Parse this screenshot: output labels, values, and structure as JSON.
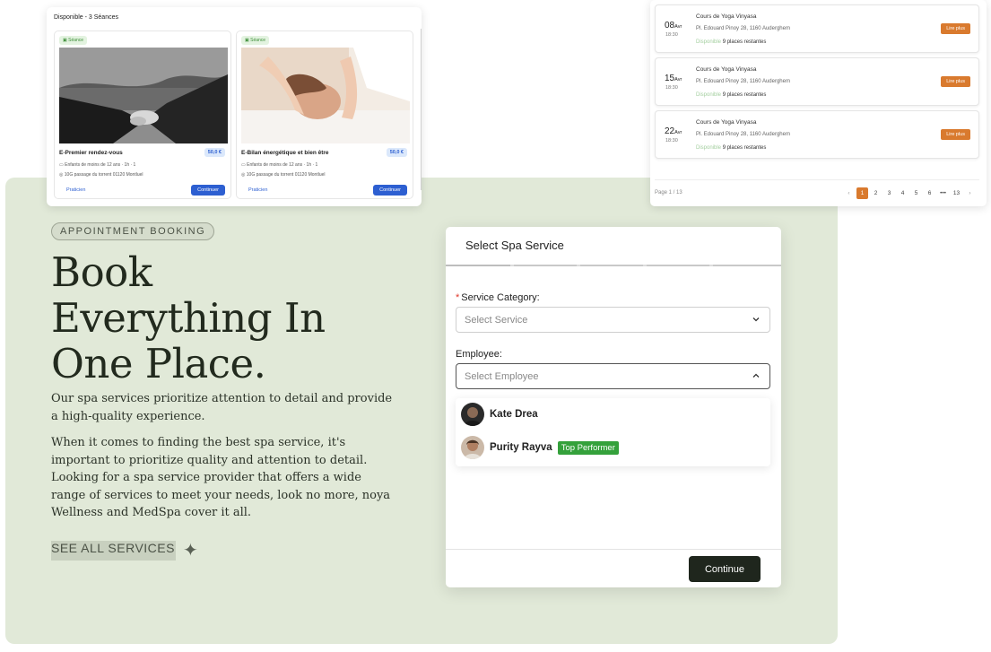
{
  "cards": {
    "title": "Disponible - 3 Séances",
    "items": [
      {
        "badge": "Séance",
        "title": "E-Premier rendez-vous",
        "price": "50,0 €",
        "meta": "Enfants de moins de 12 ans  ·  1h  ·  1",
        "address": "10G passage du torrent 01120 Montluel",
        "practitioner": "Praticien",
        "continue": "Continuer"
      },
      {
        "badge": "Séance",
        "title": "E-Bilan énergétique et bien être",
        "price": "50,0 €",
        "meta": "Enfants de moins de 12 ans  ·  1h  ·  1",
        "address": "10G passage du torrent 01120 Montluel",
        "practitioner": "Praticien",
        "continue": "Continuer"
      }
    ]
  },
  "sessions": {
    "items": [
      {
        "day": "08",
        "month": "Avr",
        "time": "18:30",
        "title": "Cours de Yoga Vinyasa",
        "address": "Pl. Edouard Pinoy 28, 1160 Auderghem",
        "available_label": "Disponible",
        "places": "9 places restantes",
        "button": "Lire plus"
      },
      {
        "day": "15",
        "month": "Avr",
        "time": "18:30",
        "title": "Cours de Yoga Vinyasa",
        "address": "Pl. Edouard Pinoy 28, 1160 Auderghem",
        "available_label": "Disponible",
        "places": "9 places restantes",
        "button": "Lire plus"
      },
      {
        "day": "22",
        "month": "Avr",
        "time": "18:30",
        "title": "Cours de Yoga Vinyasa",
        "address": "Pl. Edouard Pinoy 28, 1160 Auderghem",
        "available_label": "Disponible",
        "places": "9 places restantes",
        "button": "Lire plus"
      }
    ],
    "page_info": "Page 1 / 13",
    "pages": [
      "1",
      "2",
      "3",
      "4",
      "5",
      "6",
      "•••",
      "13"
    ],
    "active_page": "1"
  },
  "hero": {
    "eyebrow": "APPOINTMENT BOOKING",
    "heading_line1": "Book",
    "heading_line2": "Everything In",
    "heading_line3": "One Place.",
    "para1": "Our spa services prioritize attention to detail and provide a high-quality experience.",
    "para2": "When it comes to finding the best spa service, it's important to prioritize quality and attention to detail. Looking for a spa service provider that offers a wide range of services to meet your needs, look no more, noya Wellness and MedSpa cover it all.",
    "see_all": "SEE ALL SERVICES"
  },
  "modal": {
    "title": "Select Spa Service",
    "category_label": "Service Category:",
    "category_required_mark": "*",
    "category_placeholder": "Select Service",
    "employee_label": "Employee:",
    "employee_placeholder": "Select Employee",
    "employees": [
      {
        "name": "Kate Drea",
        "badge": ""
      },
      {
        "name": "Purity Rayva",
        "badge": "Top Performer"
      }
    ],
    "continue": "Continue"
  },
  "colors": {
    "panel_green": "#e1e9d8",
    "accent_orange": "#d97a2e",
    "accent_blue": "#2d5fd1",
    "dark_button": "#1f261d",
    "badge_green": "#34a13b"
  }
}
